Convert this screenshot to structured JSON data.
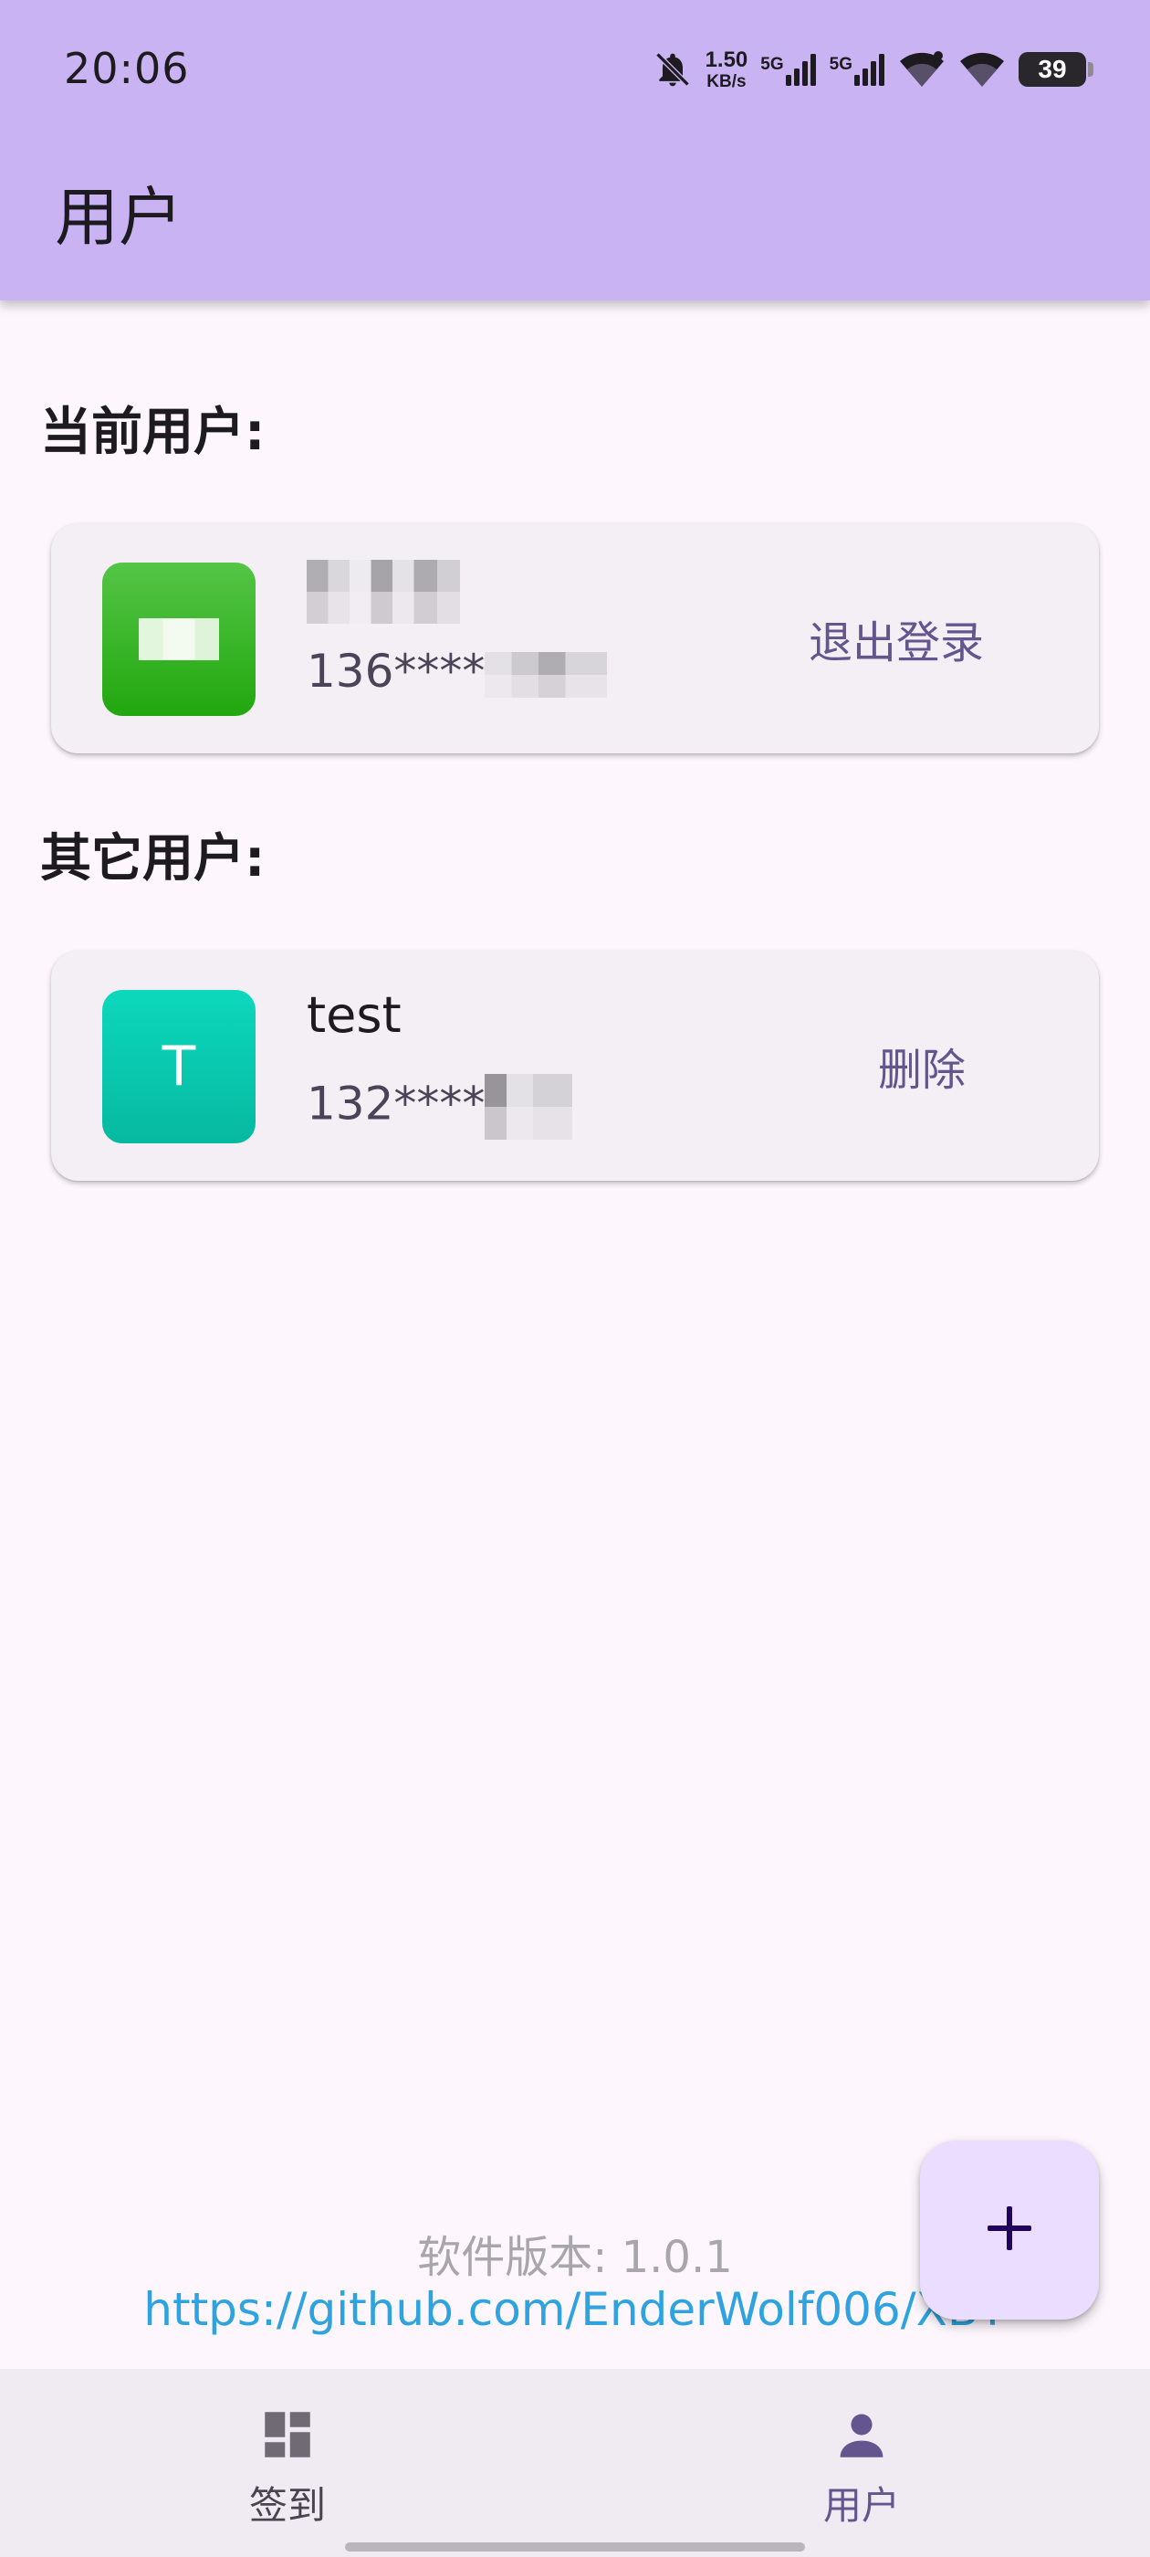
{
  "status_bar": {
    "time": "20:06",
    "net_speed_value": "1.50",
    "net_speed_unit": "KB/s",
    "sim1_label": "5G",
    "sim2_label": "5G",
    "battery": "39",
    "icons": [
      "bell-off-icon",
      "signal-icon",
      "signal-icon",
      "wifi-icon",
      "wifi-icon",
      "battery-icon"
    ]
  },
  "app_bar": {
    "title": "用户"
  },
  "current_section": {
    "title": "当前用户:",
    "user": {
      "avatar_initial": "",
      "avatar_color": "#22a70f",
      "name": "",
      "phone_prefix": "136****",
      "action_label": "退出登录"
    }
  },
  "other_section": {
    "title": "其它用户:",
    "users": [
      {
        "avatar_initial": "T",
        "avatar_color": "#06b9a0",
        "name": "test",
        "phone_prefix": "132****",
        "action_label": "删除"
      }
    ]
  },
  "footer": {
    "version_text": "软件版本: 1.0.1",
    "repo_link": "https://github.com/EnderWolf006/XBT"
  },
  "fab": {
    "icon": "plus-icon"
  },
  "bottom_nav": {
    "items": [
      {
        "label": "签到",
        "icon": "dashboard-icon",
        "selected": false
      },
      {
        "label": "用户",
        "icon": "person-icon",
        "selected": true
      }
    ]
  },
  "colors": {
    "app_bar": "#c9b3f3",
    "background": "#fdf7fd",
    "card": "#f4eff5",
    "accent": "#65558f",
    "link": "#2ea3e0",
    "fab": "#eaddff",
    "nav_background": "#f0eaf2"
  }
}
